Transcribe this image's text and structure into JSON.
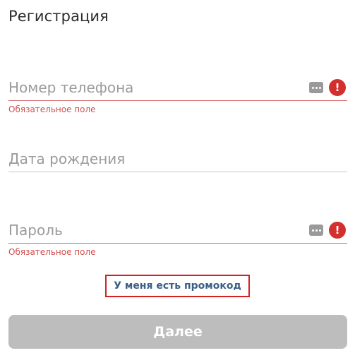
{
  "page": {
    "title": "Регистрация"
  },
  "form": {
    "phone": {
      "placeholder": "Номер телефона",
      "error": "Обязательное поле"
    },
    "birthdate": {
      "placeholder": "Дата рождения"
    },
    "password": {
      "placeholder": "Пароль",
      "error": "Обязательное поле"
    }
  },
  "promo_link": "У меня есть промокод",
  "next_button": "Далее",
  "icons": {
    "field_menu": "more-dots-icon",
    "field_error": "exclamation-alert-icon"
  },
  "colors": {
    "error": "#d32f2f",
    "link": "#3a5f86",
    "button_disabled": "#bdbdbd",
    "highlight_border": "#d62020"
  }
}
